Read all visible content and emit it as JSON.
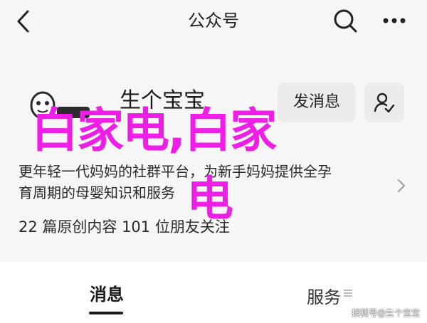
{
  "header": {
    "title": "公众号",
    "back_icon": "chevron-left-icon",
    "search_icon": "search-icon",
    "more_icon": "more-dots-icon"
  },
  "account": {
    "name": "生个宝宝",
    "avatar_text": "生个宝宝",
    "message_button": "发消息",
    "follow_icon": "user-check-icon",
    "description_line1": "更年轻一代妈妈的社群平台，为新手妈妈提供全孕",
    "description_line2": "育周期的母婴知识和服务",
    "stats": "22 篇原创内容  101 位朋友关注"
  },
  "overlay": {
    "line1": "白家电,白家",
    "line2": "电",
    "color": "#ee1ee6"
  },
  "tabs": {
    "messages": "消息",
    "services": "服务"
  },
  "watermark": "搜狐号@生个宝宝"
}
